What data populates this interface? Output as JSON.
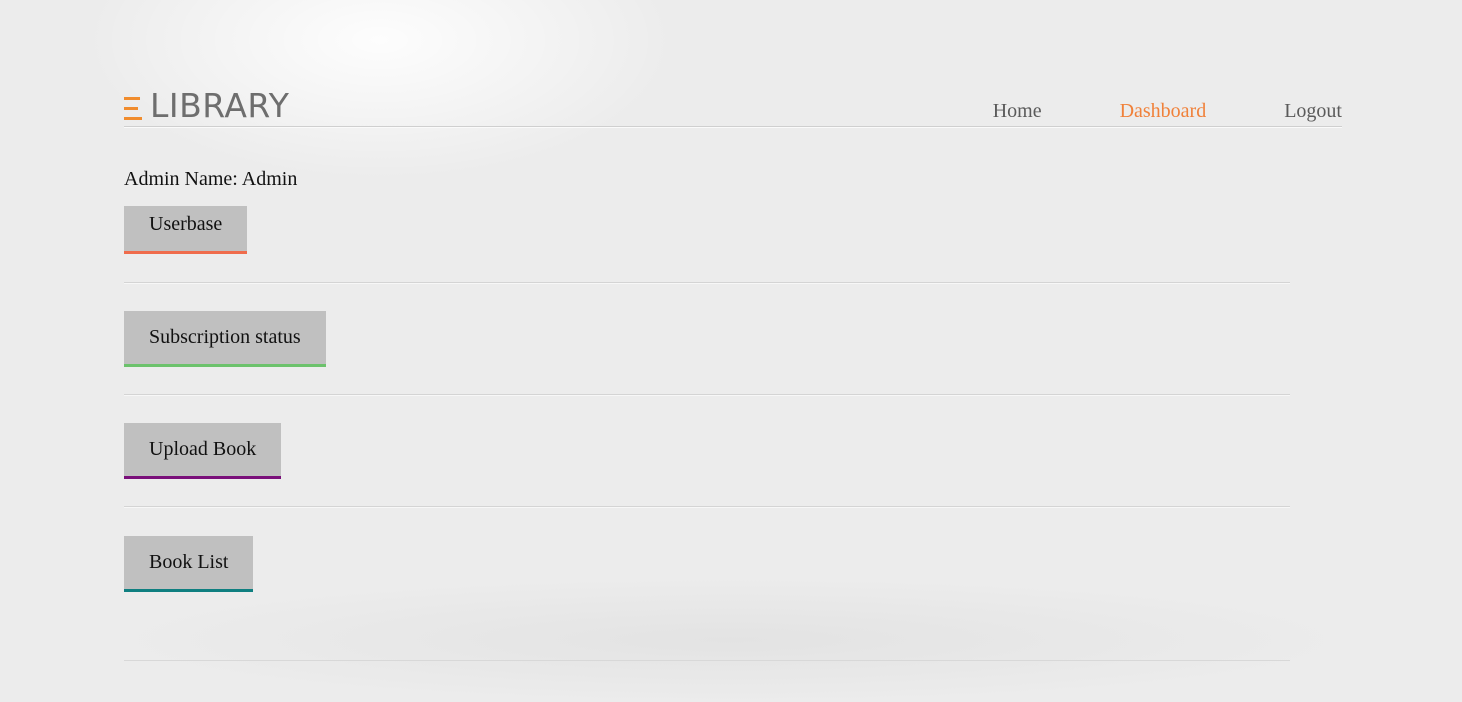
{
  "brand": {
    "logo_text": "LIBRARY",
    "logo_mark_icon": "e-letter-bars-icon",
    "accent_color": "#f08c2e"
  },
  "nav": {
    "items": [
      {
        "label": "Home",
        "active": false
      },
      {
        "label": "Dashboard",
        "active": true
      },
      {
        "label": "Logout",
        "active": false
      }
    ],
    "active_color": "#f0813a"
  },
  "admin": {
    "label": "Admin Name: Admin"
  },
  "actions": [
    {
      "label": "Userbase",
      "accent": "#ef6c4c"
    },
    {
      "label": "Subscription status",
      "accent": "#6cc26c"
    },
    {
      "label": "Upload Book",
      "accent": "#7a0f7a"
    },
    {
      "label": "Book List",
      "accent": "#0f7f80"
    }
  ]
}
